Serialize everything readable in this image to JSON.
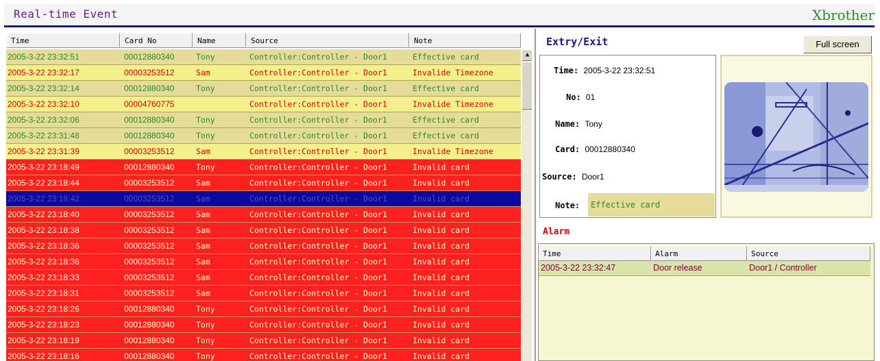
{
  "header": {
    "title": "Real-time Event",
    "brand": "Xbrother"
  },
  "colors": {
    "title": "#6b1a8c",
    "brand": "#2a8a2a",
    "accent_line": "#1a1a7a"
  },
  "events": {
    "columns": [
      "Time",
      "Card No",
      "Name",
      "Source",
      "Note"
    ],
    "rows": [
      {
        "time": "2005-3-22 23:32:51",
        "card": "00012880340",
        "name": "Tony",
        "source": "Controller:Controller - Door1",
        "note": "Effective card",
        "state": "effective"
      },
      {
        "time": "2005-3-22 23:32:17",
        "card": "00003253512",
        "name": "Sam",
        "source": "Controller:Controller - Door1",
        "note": "Invalide Timezone",
        "state": "timezone"
      },
      {
        "time": "2005-3-22 23:32:14",
        "card": "00012880340",
        "name": "Tony",
        "source": "Controller:Controller - Door1",
        "note": "Effective card",
        "state": "effective"
      },
      {
        "time": "2005-3-22 23:32:10",
        "card": "00004760775",
        "name": "",
        "source": "Controller:Controller - Door1",
        "note": "Invalide Timezone",
        "state": "timezone"
      },
      {
        "time": "2005-3-22 23:32:06",
        "card": "00012880340",
        "name": "Tony",
        "source": "Controller:Controller - Door1",
        "note": "Effective card",
        "state": "effective"
      },
      {
        "time": "2005-3-22 23:31:48",
        "card": "00012880340",
        "name": "Tony",
        "source": "Controller:Controller - Door1",
        "note": "Effective card",
        "state": "effective"
      },
      {
        "time": "2005-3-22 23:31:39",
        "card": "00003253512",
        "name": "Sam",
        "source": "Controller:Controller - Door1",
        "note": "Invalide Timezone",
        "state": "timezone"
      },
      {
        "time": "2005-3-22 23:18:49",
        "card": "00012880340",
        "name": "Tony",
        "source": "Controller:Controller - Door1",
        "note": "Invalid card",
        "state": "invalid"
      },
      {
        "time": "2005-3-22 23:18:44",
        "card": "00003253512",
        "name": "Sam",
        "source": "Controller:Controller - Door1",
        "note": "Invalid card",
        "state": "invalid"
      },
      {
        "time": "2005-3-22 23:18:42",
        "card": "00003253512",
        "name": "Sam",
        "source": "Controller:Controller - Door1",
        "note": "Invalid card",
        "state": "selected"
      },
      {
        "time": "2005-3-22 23:18:40",
        "card": "00003253512",
        "name": "Sam",
        "source": "Controller:Controller - Door1",
        "note": "Invalid card",
        "state": "invalid"
      },
      {
        "time": "2005-3-22 23:18:38",
        "card": "00003253512",
        "name": "Sam",
        "source": "Controller:Controller - Door1",
        "note": "Invalid card",
        "state": "invalid"
      },
      {
        "time": "2005-3-22 23:18:36",
        "card": "00003253512",
        "name": "Sam",
        "source": "Controller:Controller - Door1",
        "note": "Invalid card",
        "state": "invalid"
      },
      {
        "time": "2005-3-22 23:18:36",
        "card": "00003253512",
        "name": "Sam",
        "source": "Controller:Controller - Door1",
        "note": "Invalid card",
        "state": "invalid"
      },
      {
        "time": "2005-3-22 23:18:33",
        "card": "00003253512",
        "name": "Sam",
        "source": "Controller:Controller - Door1",
        "note": "Invalid card",
        "state": "invalid"
      },
      {
        "time": "2005-3-22 23:18:31",
        "card": "00003253512",
        "name": "Sam",
        "source": "Controller:Controller - Door1",
        "note": "Invalid card",
        "state": "invalid"
      },
      {
        "time": "2005-3-22 23:18:26",
        "card": "00012880340",
        "name": "Tony",
        "source": "Controller:Controller - Door1",
        "note": "Invalid card",
        "state": "invalid"
      },
      {
        "time": "2005-3-22 23:18:23",
        "card": "00012880340",
        "name": "Tony",
        "source": "Controller:Controller - Door1",
        "note": "Invalid card",
        "state": "invalid"
      },
      {
        "time": "2005-3-22 23:18:19",
        "card": "00012880340",
        "name": "Tony",
        "source": "Controller:Controller - Door1",
        "note": "Invalid card",
        "state": "invalid"
      },
      {
        "time": "2005-3-22 23:18:16",
        "card": "00012880340",
        "name": "Tony",
        "source": "Controller:Controller - Door1",
        "note": "Invalid card",
        "state": "invalid"
      }
    ],
    "state_colors": {
      "effective": {
        "bg": "#e4dc98",
        "fg": "#2a8a2a"
      },
      "timezone": {
        "bg": "#f4f08c",
        "fg": "#cc0000"
      },
      "invalid": {
        "bg": "#ff2020",
        "fg": "#ffffd0"
      },
      "selected": {
        "bg": "#0a0aa0",
        "fg": "#5050c0"
      }
    }
  },
  "entry": {
    "title": "Extry/Exit",
    "fullscreen_label": "Full screen",
    "time_label": "Time:",
    "time": "2005-3-22 23:32:51",
    "no_label": "No:",
    "no": "01",
    "name_label": "Name:",
    "name": "Tony",
    "card_label": "Card:",
    "card": "00012880340",
    "source_label": "Source:",
    "source": "Door1",
    "note_label": "Note:",
    "note": "Effective card"
  },
  "alarm": {
    "title": "Alarm",
    "columns": [
      "Time",
      "Alarm",
      "Source"
    ],
    "rows": [
      {
        "time": "2005-3-22 23:32:47",
        "alarm": "Door release",
        "source": "Door1 / Controller"
      }
    ]
  }
}
